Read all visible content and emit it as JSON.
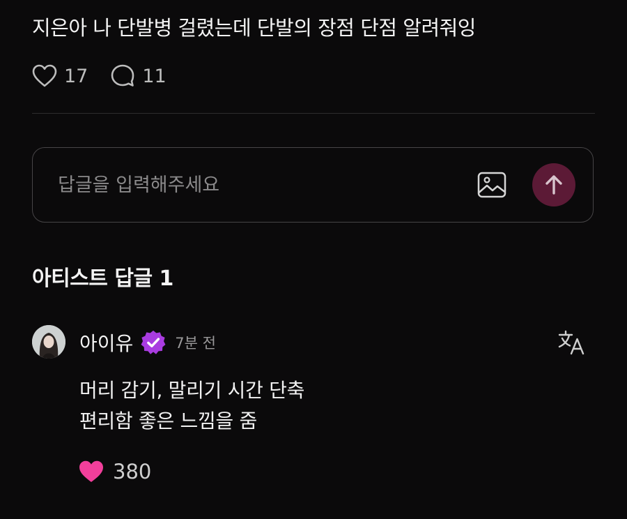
{
  "post": {
    "text": "지은아 나 단발병 걸렸는데 단발의 장점 단점 알려줘잉",
    "like_count": "17",
    "comment_count": "11"
  },
  "reply_box": {
    "placeholder": "답글을 입력해주세요"
  },
  "artist_section": {
    "title": "아티스트 답글 1"
  },
  "comment": {
    "author": "아이유",
    "time": "7분 전",
    "lines": [
      "머리 감기, 말리기 시간 단축",
      "편리함 좋은 느낌을 줌"
    ],
    "like_count": "380"
  },
  "colors": {
    "background": "#0b0a0b",
    "badge": "#a93ce0",
    "send_button": "#5c1a36",
    "heart_filled": "#f23f9b"
  },
  "icons": [
    "heart-outline-icon",
    "comment-bubble-icon",
    "image-icon",
    "arrow-up-icon",
    "verified-badge-icon",
    "translate-icon",
    "heart-filled-icon"
  ]
}
